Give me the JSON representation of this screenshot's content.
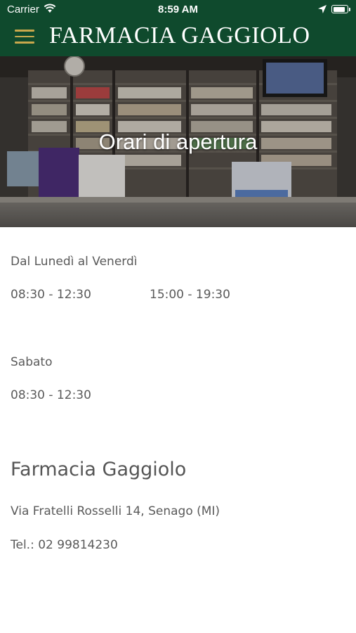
{
  "status_bar": {
    "carrier": "Carrier",
    "time": "8:59 AM",
    "battery_level": 0.92
  },
  "header": {
    "title": "FARMACIA GAGGIOLO",
    "menu_icon": "hamburger-icon",
    "bg_color": "#0f4a2d",
    "accent_color": "#c9a84c"
  },
  "hero": {
    "title": "Orari di apertura"
  },
  "hours": {
    "weekdays_label": "Dal Lunedì al Venerdì",
    "weekdays_morning": "08:30 - 12:30",
    "weekdays_afternoon": "15:00 - 19:30",
    "saturday_label": "Sabato",
    "saturday_morning": "08:30 - 12:30"
  },
  "contact": {
    "name": "Farmacia Gaggiolo",
    "address": "Via Fratelli Rosselli 14, Senago (MI)",
    "phone": "Tel.: 02 99814230"
  }
}
